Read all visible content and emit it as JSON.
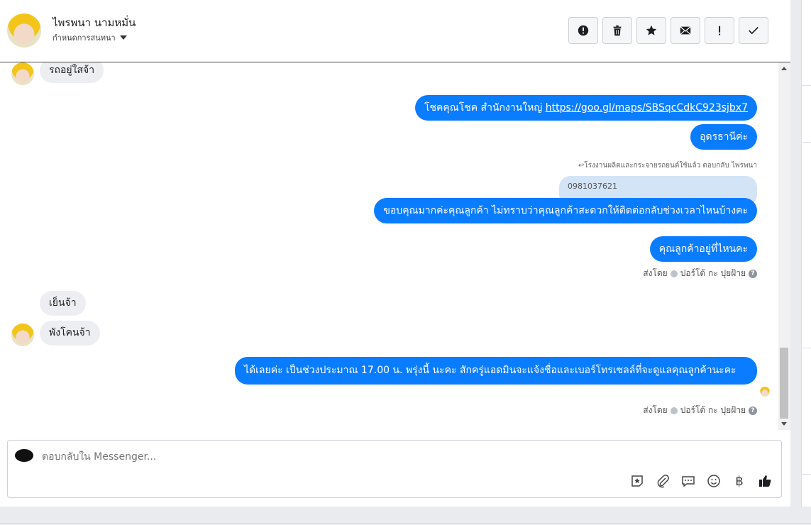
{
  "header": {
    "name": "ไพรพนา นามหมั่น",
    "subtitle": "กำหนดการสนทนา",
    "toolbar": [
      {
        "name": "report-icon",
        "label": "!"
      },
      {
        "name": "trash-icon",
        "label": ""
      },
      {
        "name": "star-icon",
        "label": ""
      },
      {
        "name": "mail-icon",
        "label": ""
      },
      {
        "name": "exclamation-icon",
        "label": "!"
      },
      {
        "name": "check-icon",
        "label": "✓"
      }
    ]
  },
  "messages": {
    "in_1": "รถอยู่ใสจ้า",
    "out_1_text": "โชคคุณโชค สำนักงานใหญ่ ",
    "out_1_link": "https://goo.gl/maps/SBSqcCdkC923sjbx7",
    "out_2": "อุดรธานีค่ะ",
    "reply_label": "โรงงานผลิตและกระจายรถยนต์ใช้แล้ว ตอบกลับ ไพรพนา",
    "quoted": "0981037621",
    "out_3": "ขอบคุณมากค่ะคุณลูกค้า ไม่ทราบว่าคุณลูกค้าสะดวกให้ติดต่อกลับช่วงเวลาไหนบ้างคะ",
    "out_4": "คุณลูกค้าอยู่ที่ไหนคะ",
    "sent_by_1": "ส่งโดย",
    "sender_1": "ปอร์โต้ กะ ปุยฝ้าย",
    "in_2": "เย็นจ้า",
    "in_3": "พังโคนจ้า",
    "out_5": "ได้เลยค่ะ เป็นช่วงประมาณ 17.00 น. พรุ่งนี้ นะคะ สักครู่แอดมินจะแจ้งชื่อและเบอร์โทรเซลล์ที่จะดูแลคุณลูกค้านะคะ",
    "sent_by_2": "ส่งโดย",
    "sender_2": "ปอร์โต้ กะ ปุยฝ้าย"
  },
  "composer": {
    "placeholder": "ตอบกลับใน Messenger...",
    "icons": [
      "sticker-icon",
      "attachment-icon",
      "saved-reply-icon",
      "emoji-icon",
      "payment-icon",
      "like-icon"
    ],
    "payment_symbol": "฿"
  },
  "colors": {
    "outgoing": "#0a7cff",
    "incoming": "#eceef1",
    "quoted": "#d3e4f7"
  }
}
